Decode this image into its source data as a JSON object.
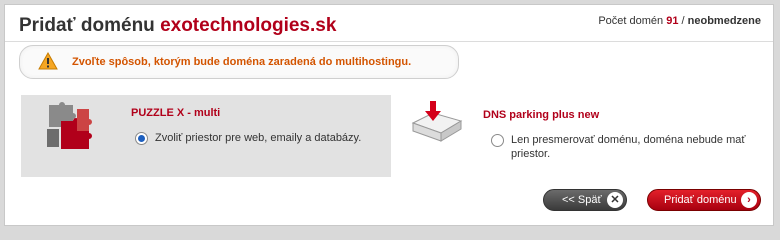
{
  "header": {
    "title_prefix": "Pridať doménu ",
    "title_domain": "exotechnologies.sk",
    "count_label": "Počet domén ",
    "count_value": "91",
    "count_sep": " / ",
    "count_limit": "neobmedzene"
  },
  "warning": {
    "icon": "warning-icon",
    "text": "Zvoľte spôsob, ktorým bude doména zaradená do multihostingu."
  },
  "options": [
    {
      "title": "PUZZLE X - multi",
      "label": "Zvoliť priestor pre web, emaily a databázy.",
      "selected": true,
      "icon": "puzzle-icon"
    },
    {
      "title": "DNS parking plus new",
      "label": "Len presmerovať doménu, doména nebude mať priestor.",
      "selected": false,
      "icon": "dns-parking-icon"
    }
  ],
  "buttons": {
    "back_label": "<< Späť",
    "back_icon": "close-icon",
    "add_label": "Pridať doménu",
    "add_icon": "chevron-right-icon"
  },
  "colors": {
    "accent": "#b1001a",
    "warning_text": "#d35400",
    "radio_selected": "#1d5fbf"
  }
}
